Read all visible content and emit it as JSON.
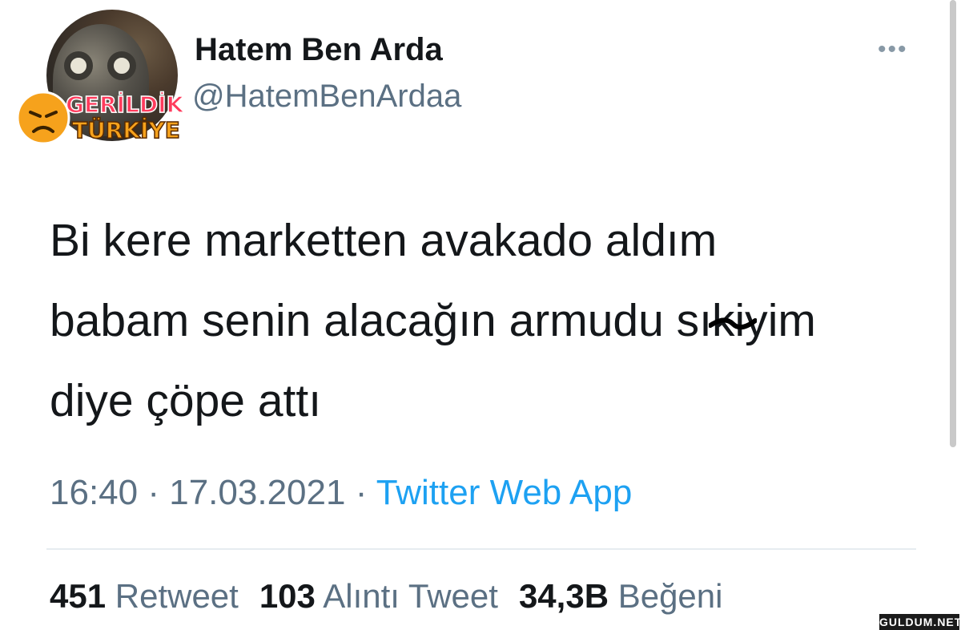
{
  "tweet": {
    "author": {
      "display_name": "Hatem Ben Arda",
      "handle": "@HatemBenArdaa",
      "avatar_icon": "gas-mask-avatar"
    },
    "sticker": {
      "line1": "GERİLDİK",
      "line2": "TÜRKİYE",
      "icon": "angry-face-icon",
      "colors": {
        "text": "#ff3b5c",
        "emoji": "#f6a21c"
      }
    },
    "more_icon": "more-dots-icon",
    "text": {
      "line1": "Bi kere marketten avakado aldım",
      "line2_before": "babam senin alacağın armudu sı",
      "line2_struck": "kiy",
      "line2_after": "im",
      "line3": "diye çöpe attı"
    },
    "meta": {
      "time": "16:40",
      "separator": "·",
      "date": "17.03.2021",
      "source": "Twitter Web App"
    },
    "stats": {
      "retweets": {
        "count": "451",
        "label": "Retweet"
      },
      "quotes": {
        "count": "103",
        "label": "Alıntı Tweet"
      },
      "likes": {
        "count": "34,3B",
        "label": "Beğeni"
      }
    }
  },
  "watermark": "GULDUM.NET",
  "colors": {
    "primary_text": "#14171a",
    "secondary_text": "#5b7083",
    "link": "#1da1f2",
    "divider": "#e6ecf0"
  }
}
